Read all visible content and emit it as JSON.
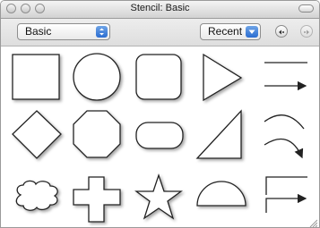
{
  "window": {
    "title": "Stencil: Basic"
  },
  "toolbar": {
    "stencil_select": {
      "value": "Basic"
    },
    "recent_select": {
      "value": "Recent"
    },
    "nav_icons": [
      "back-circle-icon",
      "forward-circle-icon"
    ]
  },
  "shapes": [
    "square",
    "circle",
    "rounded-rectangle",
    "triangle-right",
    "line",
    "diamond",
    "octagon",
    "pill",
    "right-triangle",
    "curved-line",
    "cloud",
    "cross",
    "star",
    "half-circle",
    "elbow-connector"
  ],
  "colors": {
    "accent": "#3a7bd5",
    "shape_stroke": "#2a2a2a",
    "shape_fill": "#ffffff"
  }
}
